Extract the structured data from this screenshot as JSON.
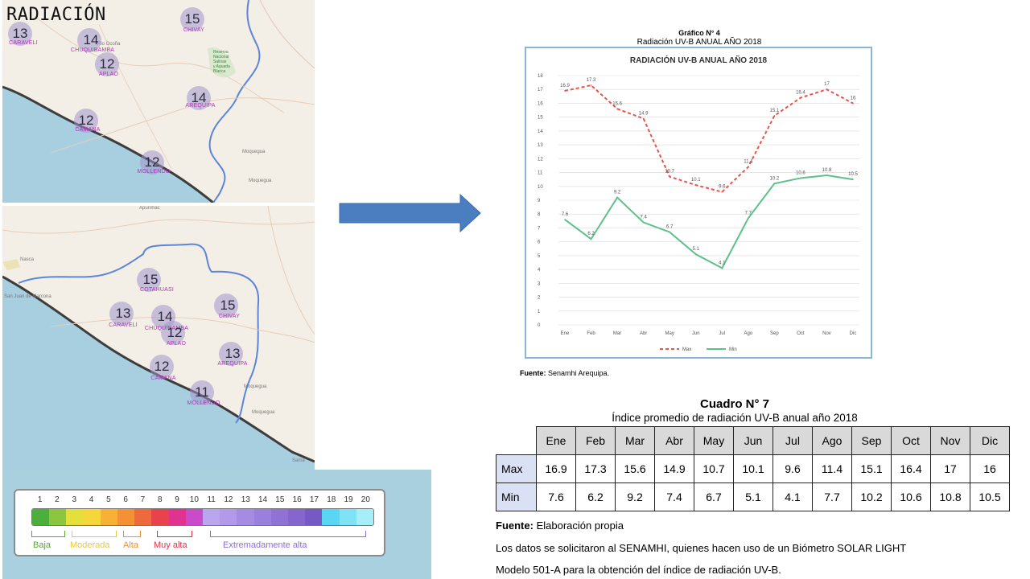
{
  "title": "RADIACIÓN",
  "map_top": {
    "markers": [
      {
        "value": "13",
        "city": "CARAVELI"
      },
      {
        "value": "14",
        "city": "CHUQUIBAMBA"
      },
      {
        "value": "12",
        "city": "APLAO"
      },
      {
        "value": "15",
        "city": "CHIVAY"
      },
      {
        "value": "14",
        "city": "AREQUIPA"
      },
      {
        "value": "12",
        "city": "CAMANA"
      },
      {
        "value": "12",
        "city": "MOLLENDO"
      }
    ]
  },
  "map_bottom": {
    "markers": [
      {
        "value": "15",
        "city": "COTAHUASI"
      },
      {
        "value": "13",
        "city": "CARAVELI"
      },
      {
        "value": "14",
        "city": "CHUQUIBAMBA"
      },
      {
        "value": "12",
        "city": "APLAO"
      },
      {
        "value": "15",
        "city": "CHIVAY"
      },
      {
        "value": "13",
        "city": "AREQUIPA"
      },
      {
        "value": "12",
        "city": "CAMANA"
      },
      {
        "value": "11",
        "city": "MOLLENDO"
      }
    ]
  },
  "legend": {
    "numbers": [
      "1",
      "2",
      "3",
      "4",
      "5",
      "6",
      "7",
      "8",
      "9",
      "10",
      "11",
      "12",
      "13",
      "14",
      "15",
      "16",
      "17",
      "18",
      "19",
      "20"
    ],
    "colors": [
      "#4caf3c",
      "#8cc63f",
      "#e3e03b",
      "#f6d63a",
      "#f7b236",
      "#f39135",
      "#ee6a3c",
      "#e8434d",
      "#e0338f",
      "#c94bc9",
      "#b9a6ef",
      "#b09ae9",
      "#a48ce3",
      "#9a80dc",
      "#8f72d4",
      "#8466cd",
      "#7659c4",
      "#59d6f2",
      "#7de3f5",
      "#a6eef8"
    ],
    "categories": [
      {
        "label": "Baja",
        "color": "#5aa63a"
      },
      {
        "label": "Moderada",
        "color": "#e7c93b"
      },
      {
        "label": "Alta",
        "color": "#f0902f"
      },
      {
        "label": "Muy alta",
        "color": "#e0334b"
      },
      {
        "label": "Extremadamente alta",
        "color": "#8a6fd0"
      }
    ]
  },
  "chart_head": {
    "title": "Gráfico N° 4",
    "subtitle": "Radiación UV-B ANUAL AÑO 2018"
  },
  "chart_data": {
    "type": "line",
    "title": "RADIACIÓN UV-B ANUAL AÑO 2018",
    "categories": [
      "Ene",
      "Feb",
      "Mar",
      "Abr",
      "May",
      "Jun",
      "Jul",
      "Ago",
      "Sep",
      "Oct",
      "Nov",
      "Dic"
    ],
    "series": [
      {
        "name": "Max",
        "values": [
          16.9,
          17.3,
          15.6,
          14.9,
          10.7,
          10.1,
          9.6,
          11.4,
          15.1,
          16.4,
          17,
          16
        ],
        "color": "#e8534a",
        "style": "dashed"
      },
      {
        "name": "Min",
        "values": [
          7.6,
          6.2,
          9.2,
          7.4,
          6.7,
          5.1,
          4.1,
          7.7,
          10.2,
          10.6,
          10.8,
          10.5
        ],
        "color": "#5cc18a",
        "style": "solid"
      }
    ],
    "ylim": [
      0,
      18
    ],
    "yticks": [
      "0",
      "1",
      "2",
      "3",
      "4",
      "5",
      "6",
      "7",
      "8",
      "9",
      "10",
      "11",
      "12",
      "13",
      "14",
      "15",
      "16",
      "17",
      "18"
    ],
    "grid": true,
    "legend": "bottom"
  },
  "chart_source": {
    "label": "Fuente:",
    "text": "Senamhi Arequipa."
  },
  "table": {
    "title": "Cuadro N° 7",
    "subtitle": "Índice promedio de radiación UV-B anual año 2018",
    "months": [
      "Ene",
      "Feb",
      "Mar",
      "Abr",
      "May",
      "Jun",
      "Jul",
      "Ago",
      "Sep",
      "Oct",
      "Nov",
      "Dic"
    ],
    "rows": [
      {
        "label": "Max",
        "values": [
          "16.9",
          "17.3",
          "15.6",
          "14.9",
          "10.7",
          "10.1",
          "9.6",
          "11.4",
          "15.1",
          "16.4",
          "17",
          "16"
        ]
      },
      {
        "label": "Min",
        "values": [
          "7.6",
          "6.2",
          "9.2",
          "7.4",
          "6.7",
          "5.1",
          "4.1",
          "7.7",
          "10.2",
          "10.6",
          "10.8",
          "10.5"
        ]
      }
    ]
  },
  "table_source": {
    "label": "Fuente:",
    "text": "Elaboración propia"
  },
  "note": {
    "line1": "Los datos se solicitaron al SENAMHI, quienes hacen uso de un Biómetro SOLAR LIGHT",
    "line2": "Modelo 501-A para la obtención del índice de radiación UV-B."
  }
}
